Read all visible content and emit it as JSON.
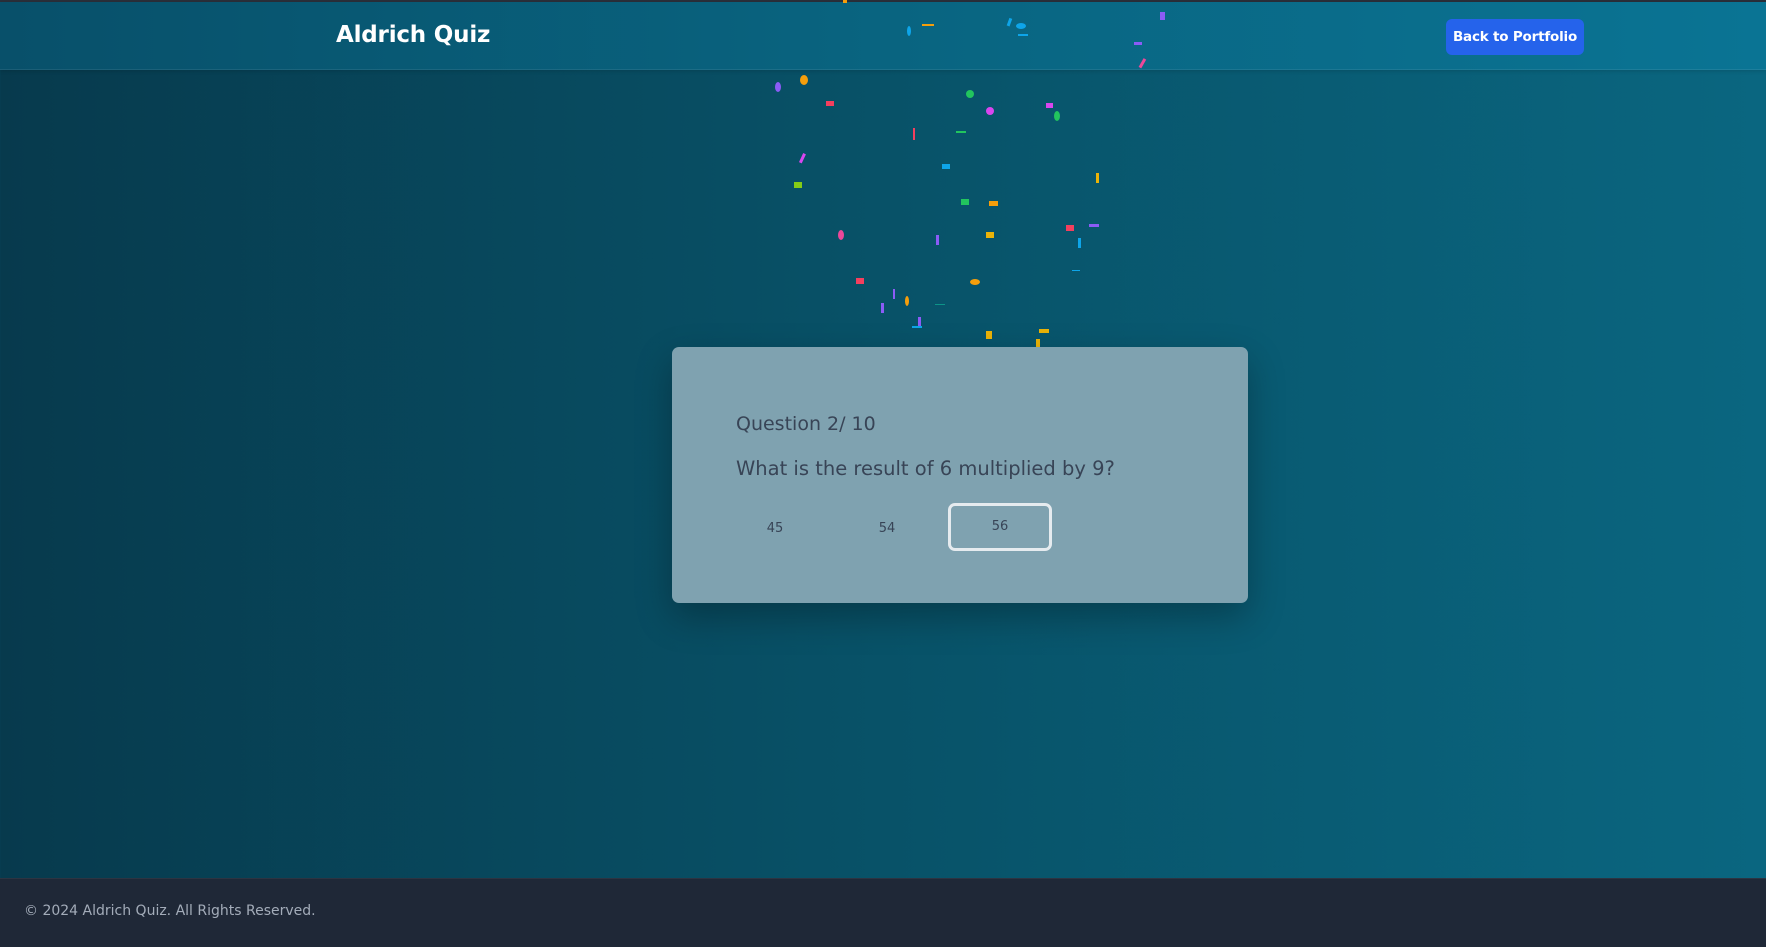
{
  "header": {
    "brand": "Aldrich Quiz",
    "back_button_label": "Back to Portfolio"
  },
  "quiz": {
    "question_counter": "Question 2/ 10",
    "question_text": "What is the result of 6 multiplied by 9?",
    "answers": [
      {
        "label": "45",
        "selected": false
      },
      {
        "label": "54",
        "selected": false
      },
      {
        "label": "56",
        "selected": true
      }
    ]
  },
  "footer": {
    "copyright": "© 2024 Aldrich Quiz. All Rights Reserved."
  },
  "colors": {
    "accent_button": "#2563eb",
    "card_background": "#7fa2b0",
    "footer_background": "#1f2837",
    "confetti_palette": [
      "#ec4899",
      "#f59e0b",
      "#22c55e",
      "#d946ef",
      "#0ea5e9",
      "#8b5cf6",
      "#eab308",
      "#84cc16",
      "#f43f5e",
      "#0d9488"
    ]
  }
}
